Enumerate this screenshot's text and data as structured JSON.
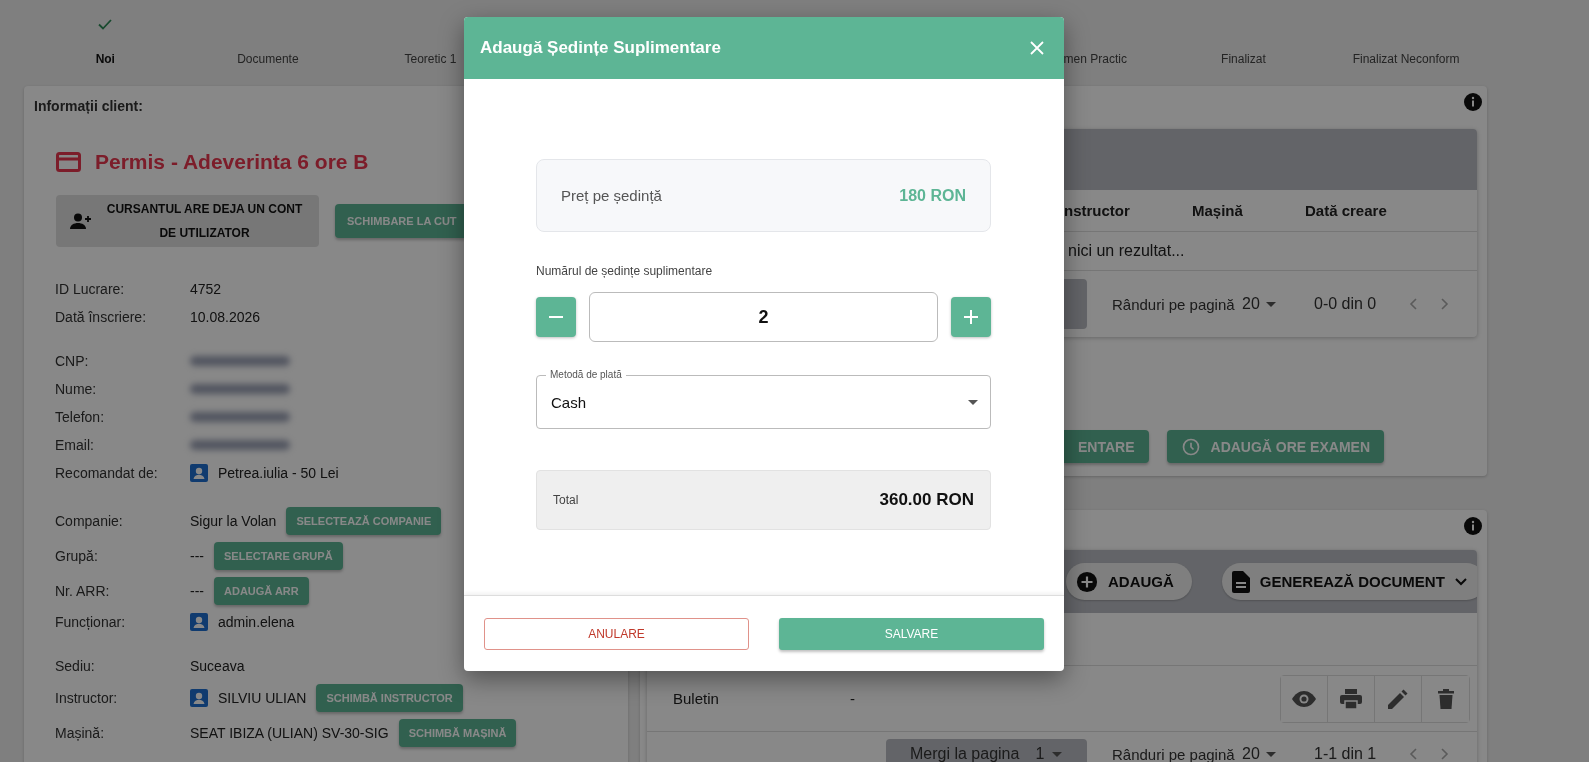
{
  "stepper": {
    "steps": [
      {
        "label": "Noi",
        "completed": true
      },
      {
        "label": "Documente",
        "completed": false
      },
      {
        "label": "Teoretic 1",
        "completed": false
      },
      {
        "label": "men Practic",
        "completed": false
      },
      {
        "label": "Finalizat",
        "completed": false
      },
      {
        "label": "Finalizat Neconform",
        "completed": false
      }
    ]
  },
  "client_card": {
    "heading": "Informații client:",
    "title": "Permis - Adeverinta 6 ore B",
    "buttons": [
      {
        "label": "CURSANTUL ARE DEJA UN CONT DE UTILIZATOR",
        "kind": "secondary"
      },
      {
        "label": "SCHIMBARE LA CUT",
        "kind": "primary"
      }
    ],
    "groups": [
      {
        "rows": [
          {
            "label": "ID Lucrare:",
            "kind": "text",
            "value": "4752"
          },
          {
            "label": "Dată înscriere:",
            "kind": "text",
            "value": "10.08.2026"
          }
        ]
      },
      {
        "rows": [
          {
            "label": "CNP:",
            "kind": "blurred"
          },
          {
            "label": "Nume:",
            "kind": "blurred"
          },
          {
            "label": "Telefon:",
            "kind": "blurred"
          },
          {
            "label": "Email:",
            "kind": "blurred"
          },
          {
            "label": "Recomandat de:",
            "kind": "user",
            "value": "Petrea.iulia - 50 Lei"
          }
        ]
      },
      {
        "rows": [
          {
            "label": "Companie:",
            "kind": "text",
            "value": "Sigur la Volan",
            "action": "SELECTEAZĂ COMPANIE"
          },
          {
            "label": "Grupă:",
            "kind": "text",
            "value": "---",
            "action": "SELECTARE GRUPĂ"
          },
          {
            "label": "Nr. ARR:",
            "kind": "text",
            "value": "---",
            "action": "ADAUGĂ ARR"
          },
          {
            "label": "Funcționar:",
            "kind": "user",
            "value": "admin.elena"
          }
        ]
      },
      {
        "rows": [
          {
            "label": "Sediu:",
            "kind": "text",
            "value": "Suceava"
          },
          {
            "label": "Instructor:",
            "kind": "user",
            "value": "SILVIU ULIAN",
            "action": "SCHIMBĂ INSTRUCTOR"
          },
          {
            "label": "Mașină:",
            "kind": "text",
            "value": "SEAT IBIZA (ULIAN) SV-30-SIG",
            "action": "SCHIMBĂ MAȘINĂ"
          }
        ]
      }
    ]
  },
  "sessions_card": {
    "table": {
      "columns": [
        "nstructor",
        "Mașină",
        "Dată creare"
      ],
      "empty_text": "nici un rezultat...",
      "pagination": {
        "rows_per_page_label": "Rânduri pe pagină",
        "rows_per_page": "20",
        "range": "0-0 din 0"
      }
    },
    "buttons": [
      {
        "label": "ENTARE"
      },
      {
        "label": "ADAUGĂ ORE EXAMEN"
      }
    ]
  },
  "documents_card": {
    "toolbar": [
      {
        "label": "ADAUGĂ",
        "dropdown": false
      },
      {
        "label": "GENEREAZĂ DOCUMENT",
        "dropdown": true
      }
    ],
    "rows": [
      {
        "name": "Buletin",
        "value": "-"
      }
    ],
    "pagination": {
      "jump_label": "Mergi la pagina",
      "page": "1",
      "rows_per_page_label": "Rânduri pe pagină",
      "rows_per_page": "20",
      "range": "1-1 din 1"
    }
  },
  "dialog": {
    "title": "Adaugă Ședințe Suplimentare",
    "price": {
      "label": "Preț pe ședință",
      "value": "180 RON"
    },
    "quantity": {
      "label": "Numărul de ședințe suplimentare",
      "value": "2"
    },
    "payment_method": {
      "label": "Metodă de plată",
      "value": "Cash"
    },
    "total": {
      "label": "Total",
      "value": "360.00 RON"
    },
    "buttons": [
      {
        "label": "ANULARE",
        "kind": "outlined"
      },
      {
        "label": "SALVARE",
        "kind": "contained"
      }
    ]
  }
}
